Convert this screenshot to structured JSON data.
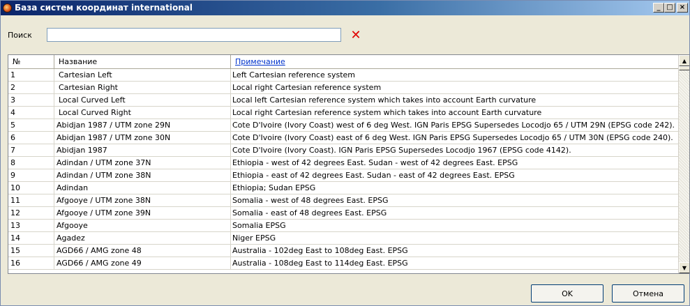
{
  "window": {
    "title": "База систем координат international",
    "controls": {
      "minimize": "_",
      "maximize": "□",
      "close": "×"
    }
  },
  "search": {
    "label": "Поиск",
    "value": "",
    "clear_icon": "✕"
  },
  "table": {
    "columns": [
      "№",
      "Название",
      "Примечание"
    ],
    "rows": [
      {
        "num": "1",
        "name": "Cartesian Left",
        "note": "Left Cartesian reference system"
      },
      {
        "num": "2",
        "name": "Cartesian Right",
        "note": "Local right Cartesian reference system"
      },
      {
        "num": "3",
        "name": "Local Curved Left",
        "note": "Local left Cartesian reference system which takes into account Earth curvature"
      },
      {
        "num": "4",
        "name": "Local Curved Right",
        "note": "Local right Cartesian reference system which takes into account Earth curvature"
      },
      {
        "num": "5",
        "name": "Abidjan 1987 / UTM zone 29N",
        "note": "Cote D'Ivoire (Ivory Coast) west of 6 deg West. IGN Paris EPSG Supersedes Locodjo 65 / UTM 29N (EPSG code 242)."
      },
      {
        "num": "6",
        "name": "Abidjan 1987 / UTM zone 30N",
        "note": "Cote D'Ivoire (Ivory Coast) east of 6 deg West. IGN Paris EPSG Supersedes Locodjo 65 / UTM 30N (EPSG code 240)."
      },
      {
        "num": "7",
        "name": "Abidjan 1987",
        "note": "Cote D'Ivoire (Ivory Coast). IGN Paris EPSG Supersedes Locodjo 1967 (EPSG code 4142)."
      },
      {
        "num": "8",
        "name": "Adindan / UTM zone 37N",
        "note": "Ethiopia - west of 42 degrees East.  Sudan - west of 42 degrees East. EPSG"
      },
      {
        "num": "9",
        "name": "Adindan / UTM zone 38N",
        "note": "Ethiopia - east of 42 degrees East.  Sudan - east of 42 degrees East. EPSG"
      },
      {
        "num": "10",
        "name": "Adindan",
        "note": "Ethiopia; Sudan EPSG"
      },
      {
        "num": "11",
        "name": "Afgooye / UTM zone 38N",
        "note": "Somalia - west of 48 degrees East. EPSG"
      },
      {
        "num": "12",
        "name": "Afgooye / UTM zone 39N",
        "note": "Somalia - east of 48 degrees East. EPSG"
      },
      {
        "num": "13",
        "name": "Afgooye",
        "note": "Somalia EPSG"
      },
      {
        "num": "14",
        "name": "Agadez",
        "note": "Niger EPSG"
      },
      {
        "num": "15",
        "name": "AGD66 / AMG zone 48",
        "note": "Australia - 102deg East to 108deg East. EPSG"
      },
      {
        "num": "16",
        "name": "AGD66 / AMG zone 49",
        "note": "Australia - 108deg East to 114deg East. EPSG"
      }
    ]
  },
  "buttons": {
    "ok": "OK",
    "cancel": "Отмена"
  },
  "colors": {
    "title_start": "#0a246a",
    "title_end": "#a6caf0",
    "link": "#0033cc",
    "clear": "#e00000"
  }
}
